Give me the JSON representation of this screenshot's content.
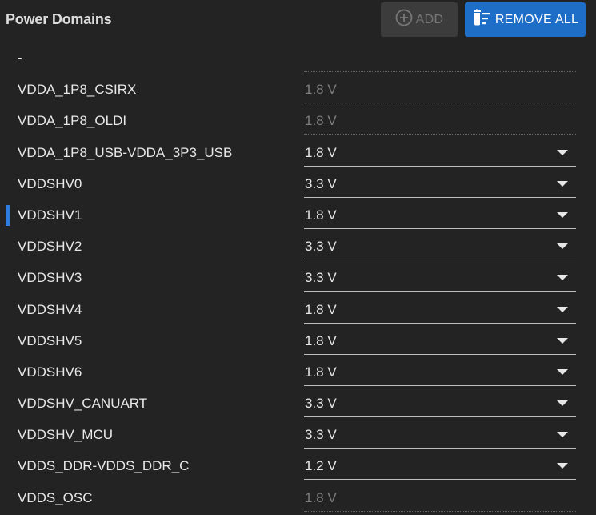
{
  "header": {
    "title": "Power Domains",
    "add_label": "ADD",
    "remove_all_label": "REMOVE ALL"
  },
  "colors": {
    "background": "#232323",
    "primary_button": "#1e6ec8",
    "disabled_button": "#3c3c3c",
    "active_indicator": "#2f7be0"
  },
  "rows": [
    {
      "name": "-",
      "value": "",
      "editable": false,
      "active": false
    },
    {
      "name": "VDDA_1P8_CSIRX",
      "value": "1.8 V",
      "editable": false,
      "active": false
    },
    {
      "name": "VDDA_1P8_OLDI",
      "value": "1.8 V",
      "editable": false,
      "active": false
    },
    {
      "name": "VDDA_1P8_USB-VDDA_3P3_USB",
      "value": "1.8 V",
      "editable": true,
      "active": false
    },
    {
      "name": "VDDSHV0",
      "value": "3.3 V",
      "editable": true,
      "active": false
    },
    {
      "name": "VDDSHV1",
      "value": "1.8 V",
      "editable": true,
      "active": true
    },
    {
      "name": "VDDSHV2",
      "value": "3.3 V",
      "editable": true,
      "active": false
    },
    {
      "name": "VDDSHV3",
      "value": "3.3 V",
      "editable": true,
      "active": false
    },
    {
      "name": "VDDSHV4",
      "value": "1.8 V",
      "editable": true,
      "active": false
    },
    {
      "name": "VDDSHV5",
      "value": "1.8 V",
      "editable": true,
      "active": false
    },
    {
      "name": "VDDSHV6",
      "value": "1.8 V",
      "editable": true,
      "active": false
    },
    {
      "name": "VDDSHV_CANUART",
      "value": "3.3 V",
      "editable": true,
      "active": false
    },
    {
      "name": "VDDSHV_MCU",
      "value": "3.3 V",
      "editable": true,
      "active": false
    },
    {
      "name": "VDDS_DDR-VDDS_DDR_C",
      "value": "1.2 V",
      "editable": true,
      "active": false
    },
    {
      "name": "VDDS_OSC",
      "value": "1.8 V",
      "editable": false,
      "active": false
    }
  ]
}
